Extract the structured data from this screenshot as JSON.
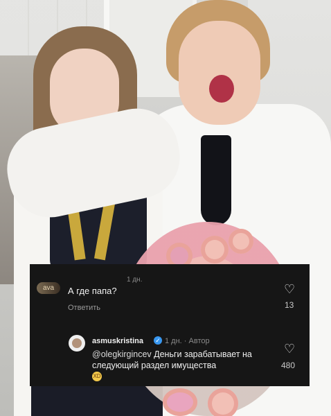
{
  "overlay": {
    "top_time": "1 дн.",
    "comment1": {
      "avatar_label": "ava",
      "text": "А где папа?",
      "reply_label": "Ответить",
      "like_icon": "heart-outline-icon",
      "like_count": "13"
    },
    "comment2": {
      "username": "asmuskristina",
      "verified_icon": "verified-badge-icon",
      "meta": "1 дн. · Автор",
      "mention": "@olegkirgincev",
      "text": "Деньги зарабатывает на следующий раздел имущества",
      "emoji": "😂",
      "like_icon": "heart-outline-icon",
      "like_count": "480"
    }
  }
}
